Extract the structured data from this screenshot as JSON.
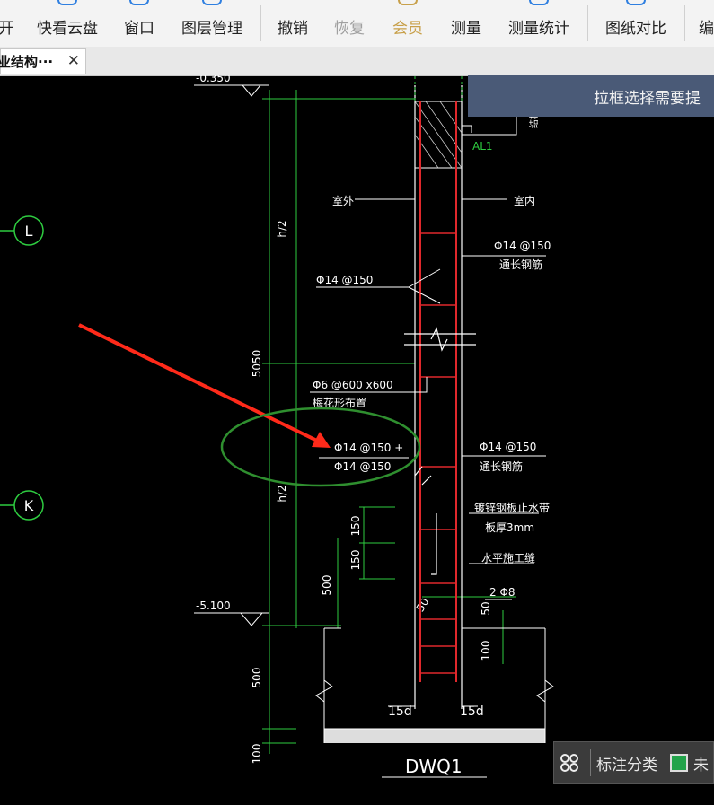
{
  "toolbar": {
    "items": [
      "开",
      "快看云盘",
      "窗口",
      "图层管理",
      "撤销",
      "恢复",
      "会员",
      "测量",
      "测量统计",
      "图纸对比",
      "编"
    ]
  },
  "tab": {
    "title": "业结构···",
    "close": "✕"
  },
  "banner": {
    "text": "拉框选择需要提"
  },
  "annotation_panel": {
    "label": "标注分类",
    "check_label": "未"
  },
  "drawing": {
    "axis_L": "L",
    "axis_K": "K",
    "elev_top": "-0.350",
    "elev_bottom": "-5.100",
    "dim_h2_upper": "h/2",
    "dim_h2_lower": "h/2",
    "dim_5050": "5050",
    "dim_500": "500",
    "dim_100": "100",
    "dim_150a": "150",
    "dim_150b": "150",
    "dim_500b": "500",
    "dim_50": "50",
    "dim_100b": "100",
    "dim_50b": "50",
    "outside": "室外",
    "inside": "室内",
    "al1": "AL1",
    "rebar_right1": "Φ14 @150",
    "rebar_right1_note": "通长钢筋",
    "rebar_left1": "Φ14 @150",
    "tie": "Φ6 @600 x600",
    "tie_note": "梅花形布置",
    "rebar_left2a": "Φ14 @150 +",
    "rebar_left2b": "Φ14 @150",
    "rebar_right2": "Φ14 @150",
    "rebar_right2_note": "通长钢筋",
    "waterstop1": "镀锌钢板止水带",
    "waterstop2": "板厚3mm",
    "joint": "水平施工缝",
    "bars_2": "2 Φ8",
    "left_15d": "15d",
    "right_15d": "15d",
    "wall_name": "DWQ1",
    "side_text": "结构"
  }
}
